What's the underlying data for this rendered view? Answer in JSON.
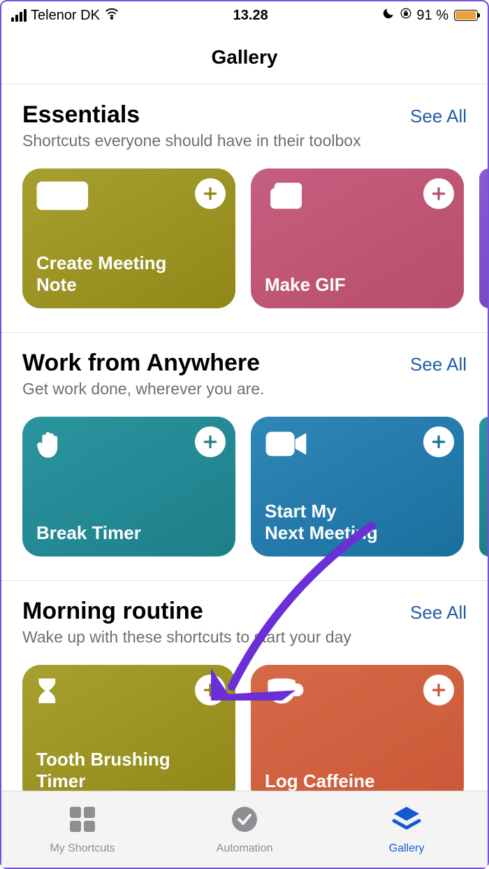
{
  "status": {
    "carrier": "Telenor DK",
    "time": "13.28",
    "battery_pct": "91 %"
  },
  "page_title": "Gallery",
  "see_all_label": "See All",
  "sections": [
    {
      "title": "Essentials",
      "subtitle": "Shortcuts everyone should have in their toolbox",
      "cards": [
        {
          "label": "Create Meeting\nNote",
          "icon": "keyboard-icon",
          "color": "olive"
        },
        {
          "label": "Make GIF",
          "icon": "photos-icon",
          "color": "rose"
        }
      ],
      "peek_right_color": "purple"
    },
    {
      "title": "Work from Anywhere",
      "subtitle": "Get work done, wherever you are.",
      "cards": [
        {
          "label": "Break Timer",
          "icon": "hand-icon",
          "color": "teal"
        },
        {
          "label": "Start My\nNext Meeting",
          "icon": "video-icon",
          "color": "blue"
        }
      ],
      "peek_right_color": "teal"
    },
    {
      "title": "Morning routine",
      "subtitle": "Wake up with these shortcuts to start your day",
      "cards": [
        {
          "label": "Tooth Brushing\nTimer",
          "icon": "hourglass-icon",
          "color": "olive"
        },
        {
          "label": "Log Caffeine",
          "icon": "coffee-icon",
          "color": "orange"
        }
      ],
      "peek_left_color": "purple"
    }
  ],
  "tabs": [
    {
      "label": "My Shortcuts",
      "icon": "grid-icon",
      "active": false
    },
    {
      "label": "Automation",
      "icon": "clock-check-icon",
      "active": false
    },
    {
      "label": "Gallery",
      "icon": "layers-icon",
      "active": true
    }
  ]
}
